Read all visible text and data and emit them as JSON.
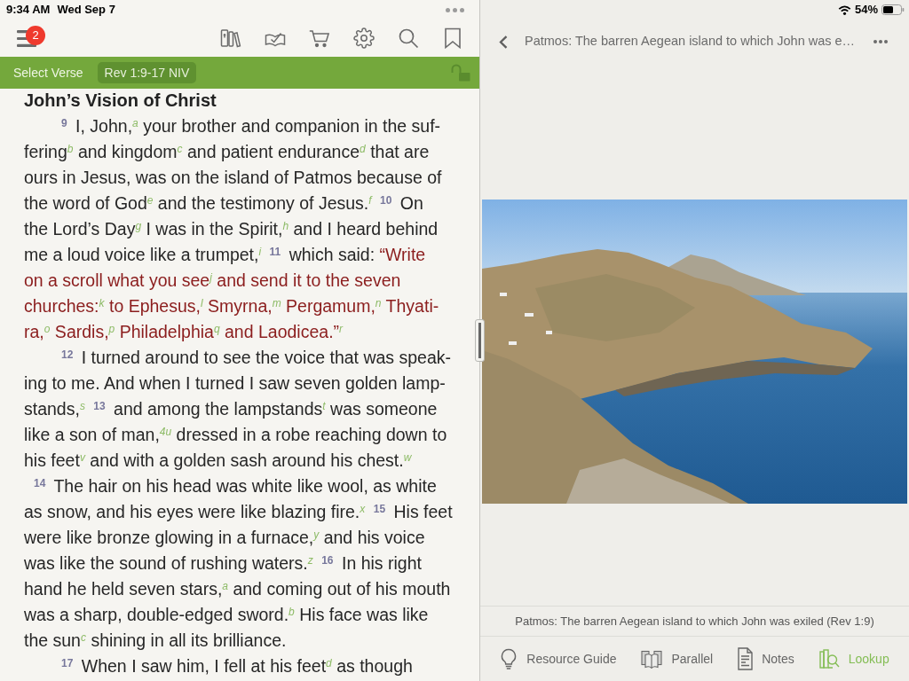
{
  "status_bar": {
    "time": "9:34 AM",
    "date": "Wed Sep 7",
    "battery": "54%"
  },
  "reader": {
    "toolbar": {
      "menu_badge": "2"
    },
    "verse_bar": {
      "label": "Select Verse",
      "reference": "Rev 1:9-17 NIV",
      "locked": false
    },
    "passage": {
      "heading": "John’s Vision of Christ",
      "paragraphs": [
        {
          "kind": "paragraph",
          "runs": [
            {
              "kind": "plain",
              "text": "**$^{9}$** I, John,$^{a}$ your brother and companion in the suf-\nfering$^{b}$ and kingdom$^{c}$ and patient endurance$^{d}$ that are\nours in Jesus, was on the island of Patmos because of\nthe word of God$^{e}$ and the testimony of Jesus.$^{f}$ **$^{10}$** On\nthe Lord’s Day$^{g}$ I was in the Spirit,$^{h}$ and I heard behind\nme a loud voice like a trumpet,$^{i}$ **$^{11}$** which said: "
            },
            {
              "kind": "red_letter",
              "text": "“Write\non a scroll what you see$^{j}$ and send it to the seven\nchurches:$^{k}$ to Ephesus,$^{l}$ Smyrna,$^{m}$ Pergamum,$^{n}$ Thyati-\nra,$^{o}$ Sardis,$^{p}$ Philadelphia$^{q}$ and Laodicea.”"
            },
            {
              "kind": "plain",
              "text": "$^{r}$"
            }
          ]
        },
        {
          "kind": "paragraph",
          "runs": [
            {
              "kind": "plain",
              "text": "**$^{12}$** I turned around to see the voice that was speak-\ning to me. And when I turned I saw seven golden lamp-\nstands,$^{s}$ **$^{13}$** and among the lampstands$^{t}$ was someone\nlike a son of man,$^{4u}$ dressed in a robe reaching down to\nhis feet$^{v}$ and with a golden sash around his chest.$^{w}$"
            }
          ]
        },
        {
          "kind": "continuation",
          "runs": [
            {
              "kind": "plain",
              "text": "**$^{14}$** The hair on his head was white like wool, as white\nas snow, and his eyes were like blazing fire.$^{x}$ **$^{15}$** His feet\nwere like bronze glowing in a furnace,$^{y}$ and his voice\nwas like the sound of rushing waters.$^{z}$ **$^{16}$** In his right\nhand he held seven stars,$^{a}$ and coming out of his mouth\nwas a sharp, double-edged sword.$^{b}$ His face was like\nthe sun$^{c}$ shining in all its brilliance."
            }
          ]
        },
        {
          "kind": "paragraph",
          "runs": [
            {
              "kind": "plain",
              "text": "**$^{17}$** When I saw him, I fell at his feet$^{d}$ as though"
            }
          ]
        }
      ]
    }
  },
  "lookup_panel": {
    "header": {
      "title": "Patmos: The barren Aegean island to which John was e…"
    },
    "caption": "Patmos: The barren Aegean island to which John was exiled (Rev 1:9)",
    "tabs": [
      {
        "kind": "lightbulb",
        "label": "Resource Guide",
        "selected": false
      },
      {
        "kind": "parallel",
        "label": "Parallel",
        "selected": false
      },
      {
        "kind": "notes",
        "label": "Notes",
        "selected": false
      },
      {
        "kind": "lookup",
        "label": "Lookup",
        "selected": true
      }
    ]
  }
}
